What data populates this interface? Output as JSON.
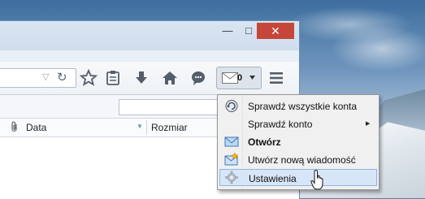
{
  "window": {
    "controls": {
      "minimize": "—",
      "maximize": "□",
      "close": "✕"
    }
  },
  "toolbar": {
    "icons": [
      "bookmark-star-icon",
      "bookmarks-list-icon",
      "download-icon",
      "home-icon",
      "chat-icon",
      "mail-icon",
      "hamburger-menu-icon"
    ],
    "mail_badge": "0"
  },
  "message_list": {
    "columns": [
      {
        "label": "Data"
      },
      {
        "label": "Rozmiar"
      }
    ]
  },
  "context_menu": {
    "items": [
      {
        "label": "Sprawdź wszystkie konta",
        "icon": "refresh-icon"
      },
      {
        "label": "Sprawdź konto",
        "icon": "",
        "submenu": true
      },
      {
        "label": "Otwórz",
        "icon": "envelope-icon",
        "bold": true
      },
      {
        "label": "Utwórz nową wiadomość",
        "icon": "new-message-icon"
      },
      {
        "label": "Ustawienia",
        "icon": "settings-gear-icon",
        "hovered": true
      }
    ]
  },
  "colors": {
    "close_button": "#c7463a",
    "menu_hover": "#d7e6f7",
    "menu_hover_border": "#8cb4e3"
  }
}
